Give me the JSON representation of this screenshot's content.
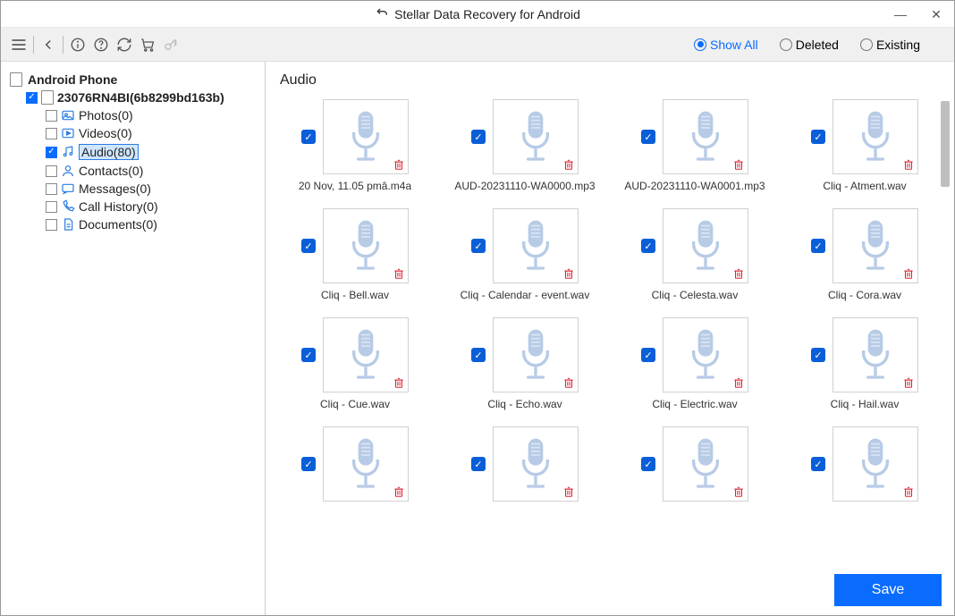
{
  "title": "Stellar Data Recovery for Android",
  "filters": {
    "show_all": "Show All",
    "deleted": "Deleted",
    "existing": "Existing",
    "selected": "show_all"
  },
  "sidebar": {
    "root": "Android Phone",
    "device": "23076RN4BI(6b8299bd163b)",
    "cats": [
      {
        "label": "Photos(0)",
        "checked": false
      },
      {
        "label": "Videos(0)",
        "checked": false
      },
      {
        "label": "Audio(80)",
        "checked": true,
        "selected": true
      },
      {
        "label": "Contacts(0)",
        "checked": false
      },
      {
        "label": "Messages(0)",
        "checked": false
      },
      {
        "label": "Call History(0)",
        "checked": false
      },
      {
        "label": "Documents(0)",
        "checked": false
      }
    ]
  },
  "content": {
    "heading": "Audio",
    "files": [
      "20 Nov, 11.05 pmâ.m4a",
      "AUD-20231110-WA0000.mp3",
      "AUD-20231110-WA0001.mp3",
      "Cliq - Atment.wav",
      "Cliq - Bell.wav",
      "Cliq - Calendar - event.wav",
      "Cliq - Celesta.wav",
      "Cliq - Cora.wav",
      "Cliq - Cue.wav",
      "Cliq - Echo.wav",
      "Cliq - Electric.wav",
      "Cliq - Hail.wav",
      "",
      "",
      "",
      ""
    ]
  },
  "buttons": {
    "save": "Save"
  }
}
